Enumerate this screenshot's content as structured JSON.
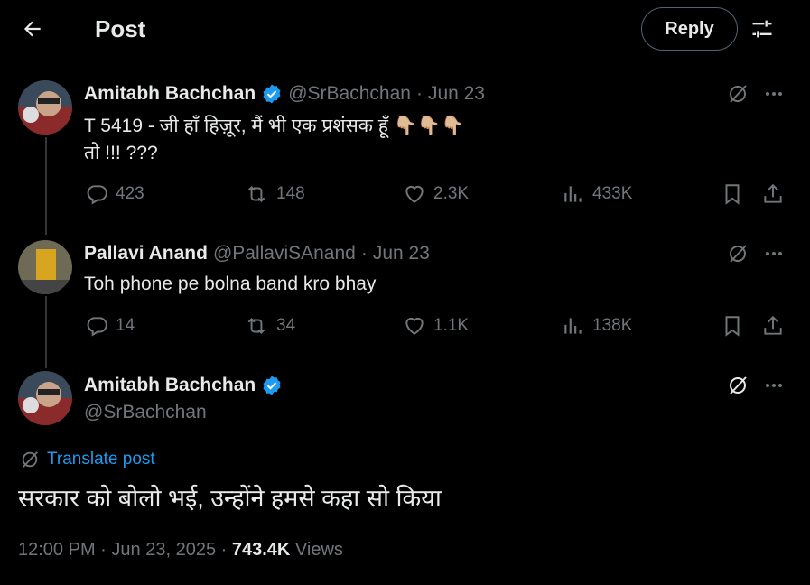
{
  "header": {
    "back_icon": "arrow-left-icon",
    "title": "Post",
    "reply_label": "Reply",
    "settings_icon": "sliders-icon"
  },
  "tweets": [
    {
      "name": "Amitabh Bachchan",
      "handle": "@SrBachchan",
      "separator": "·",
      "date": "Jun 23",
      "text_line1": "T 5419 - जी हाँ हिज़ूर, मैं भी एक प्रशंसक हूँ  👇🏼👇🏼👇🏼",
      "text_line2": "तो  !!! ???",
      "replies": "423",
      "reposts": "148",
      "likes": "2.3K",
      "views": "433K"
    },
    {
      "name": "Pallavi Anand",
      "handle": "@PallaviSAnand",
      "separator": "·",
      "date": "Jun 23",
      "text_line1": "Toh phone pe bolna band kro bhay",
      "replies": "14",
      "reposts": "34",
      "likes": "1.1K",
      "views": "138K"
    }
  ],
  "main_tweet": {
    "name": "Amitabh Bachchan",
    "handle": "@SrBachchan",
    "translate_label": "Translate post",
    "text": "सरकार को बोलो भई, उन्होंने हमसे कहा सो किया",
    "time": "12:00 PM",
    "separator": "·",
    "date": "Jun 23, 2025",
    "views_count": "743.4K",
    "views_label": "Views"
  },
  "colors": {
    "background": "#000000",
    "primary_text": "#e7e9ea",
    "secondary_text": "#71767b",
    "link": "#1d9bf0",
    "verified": "#1d9bf0"
  }
}
